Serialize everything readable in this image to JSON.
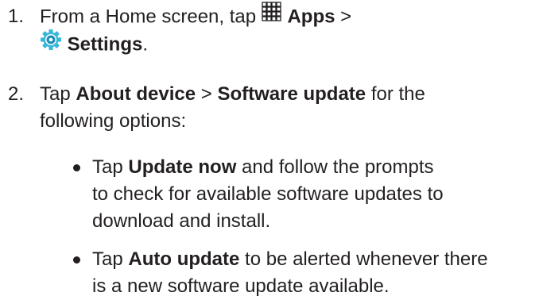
{
  "steps": [
    {
      "number": "1.",
      "line1_prefix": "From a Home screen, tap",
      "apps_label": "Apps",
      "separator": ">",
      "settings_label": "Settings",
      "period": "."
    },
    {
      "number": "2.",
      "line1_prefix": "Tap",
      "about_label": "About device",
      "separator": ">",
      "software_label": "Software update",
      "line1_suffix": "for the",
      "line2": "following options:",
      "bullets": [
        {
          "tap": "Tap",
          "label": "Update now",
          "rest1": "and follow the prompts",
          "rest2": "to check for available software updates to",
          "rest3": "download and install."
        },
        {
          "tap": "Tap",
          "label": "Auto update",
          "rest1": "to be alerted whenever there",
          "rest2": "is a new software update available."
        }
      ]
    }
  ],
  "icons": {
    "apps": "apps-grid-icon",
    "settings": "settings-gear-icon"
  },
  "colors": {
    "text": "#231f20",
    "settings_icon_outer": "#39b6d8",
    "settings_icon_inner": "#1b8fb5"
  }
}
